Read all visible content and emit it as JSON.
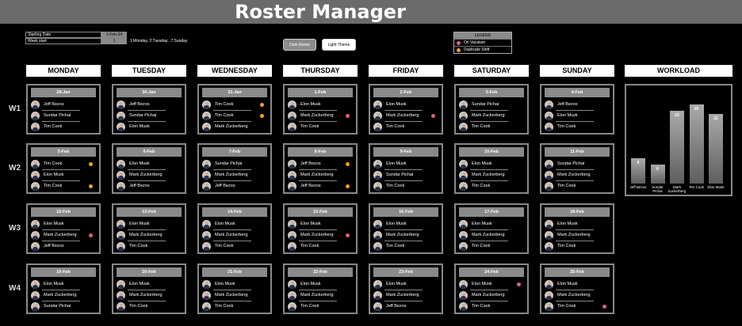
{
  "app": {
    "title": "Roster Manager"
  },
  "settings": {
    "starting_date_label": "Starting Date",
    "starting_date_value": "1-Feb-24",
    "week_start_label": "Week start",
    "week_start_value": "1",
    "week_start_hint": "1:Monday, 2:Tuesday...7:Sunday"
  },
  "theme_buttons": {
    "dark": "Dark theme",
    "light": "Light Theme"
  },
  "legend": {
    "title": "LEGEND",
    "items": [
      {
        "label": "On Vacation",
        "color": "#e0607a"
      },
      {
        "label": "Duplicate Shift",
        "color": "#f0a030"
      }
    ]
  },
  "days": [
    "MONDAY",
    "TUESDAY",
    "WEDNESDAY",
    "THURSDAY",
    "FRIDAY",
    "SATURDAY",
    "SUNDAY"
  ],
  "workload_title": "WORKLOAD",
  "weeks": [
    {
      "label": "W1",
      "cells": [
        {
          "date": "29-Jan",
          "people": [
            {
              "name": "Jeff Bezos"
            },
            {
              "name": "Sundar Pichai"
            },
            {
              "name": "Tim Cook"
            }
          ]
        },
        {
          "date": "30-Jan",
          "people": [
            {
              "name": "Jeff Bezos"
            },
            {
              "name": "Sundar Pichai"
            },
            {
              "name": "Elon Musk"
            }
          ]
        },
        {
          "date": "31-Jan",
          "people": [
            {
              "name": "Tim Cook",
              "mark": "duplicate"
            },
            {
              "name": "Tim Cook",
              "mark": "duplicate"
            },
            {
              "name": "Mark Zuckerberg"
            }
          ]
        },
        {
          "date": "1-Feb",
          "people": [
            {
              "name": "Elon Musk"
            },
            {
              "name": "Mark Zuckerberg",
              "mark": "vacation"
            },
            {
              "name": "Tim Cook"
            }
          ]
        },
        {
          "date": "2-Feb",
          "people": [
            {
              "name": "Elon Musk"
            },
            {
              "name": "Mark Zuckerberg",
              "mark": "vacation"
            },
            {
              "name": "Tim Cook"
            }
          ]
        },
        {
          "date": "3-Feb",
          "people": [
            {
              "name": "Sundar Pichai"
            },
            {
              "name": "Mark Zuckerberg"
            },
            {
              "name": "Tim Cook"
            }
          ]
        },
        {
          "date": "4-Feb",
          "people": [
            {
              "name": "Jeff Bezos"
            },
            {
              "name": "Elon Musk"
            },
            {
              "name": "Tim Cook"
            }
          ]
        }
      ]
    },
    {
      "label": "W2",
      "cells": [
        {
          "date": "5-Feb",
          "people": [
            {
              "name": "Tim Cook",
              "mark": "duplicate"
            },
            {
              "name": "Elon Musk"
            },
            {
              "name": "Tim Cook",
              "mark": "duplicate"
            }
          ]
        },
        {
          "date": "6-Feb",
          "people": [
            {
              "name": "Elon Musk"
            },
            {
              "name": "Mark Zuckerberg"
            },
            {
              "name": "Jeff Bezos"
            }
          ]
        },
        {
          "date": "7-Feb",
          "people": [
            {
              "name": "Sundar Pichai"
            },
            {
              "name": "Mark Zuckerberg"
            },
            {
              "name": "Jeff Bezos"
            }
          ]
        },
        {
          "date": "8-Feb",
          "people": [
            {
              "name": "Jeff Bezos",
              "mark": "duplicate"
            },
            {
              "name": "Mark Zuckerberg"
            },
            {
              "name": "Jeff Bezos",
              "mark": "duplicate"
            }
          ]
        },
        {
          "date": "9-Feb",
          "people": [
            {
              "name": "Elon Musk"
            },
            {
              "name": "Sundar Pichai"
            },
            {
              "name": "Tim Cook"
            }
          ]
        },
        {
          "date": "10-Feb",
          "people": [
            {
              "name": "Elon Musk"
            },
            {
              "name": "Mark Zuckerberg"
            },
            {
              "name": "Tim Cook"
            }
          ]
        },
        {
          "date": "11-Feb",
          "people": [
            {
              "name": "Sundar Pichai"
            },
            {
              "name": "Mark Zuckerberg"
            },
            {
              "name": "Tim Cook"
            }
          ]
        }
      ]
    },
    {
      "label": "W3",
      "cells": [
        {
          "date": "12-Feb",
          "people": [
            {
              "name": "Elon Musk"
            },
            {
              "name": "Mark Zuckerberg",
              "mark": "vacation"
            },
            {
              "name": "Jeff Bezos"
            }
          ]
        },
        {
          "date": "13-Feb",
          "people": [
            {
              "name": "Elon Musk"
            },
            {
              "name": "Mark Zuckerberg"
            },
            {
              "name": "Tim Cook"
            }
          ]
        },
        {
          "date": "14-Feb",
          "people": [
            {
              "name": "Elon Musk"
            },
            {
              "name": "Mark Zuckerberg"
            },
            {
              "name": "Tim Cook"
            }
          ]
        },
        {
          "date": "15-Feb",
          "people": [
            {
              "name": "Elon Musk"
            },
            {
              "name": "Mark Zuckerberg",
              "mark": "vacation"
            },
            {
              "name": "Tim Cook"
            }
          ]
        },
        {
          "date": "16-Feb",
          "people": [
            {
              "name": "Elon Musk"
            },
            {
              "name": "Mark Zuckerberg"
            },
            {
              "name": "Tim Cook"
            }
          ]
        },
        {
          "date": "17-Feb",
          "people": [
            {
              "name": "Elon Musk"
            },
            {
              "name": "Mark Zuckerberg"
            },
            {
              "name": "Tim Cook"
            }
          ]
        },
        {
          "date": "18-Feb",
          "people": [
            {
              "name": "Elon Musk"
            },
            {
              "name": "Mark Zuckerberg"
            },
            {
              "name": "Tim Cook"
            }
          ]
        }
      ]
    },
    {
      "label": "W4",
      "cells": [
        {
          "date": "19-Feb",
          "people": [
            {
              "name": "Elon Musk"
            },
            {
              "name": "Mark Zuckerberg"
            },
            {
              "name": "Sundar Pichai"
            }
          ]
        },
        {
          "date": "20-Feb",
          "people": [
            {
              "name": "Elon Musk"
            },
            {
              "name": "Mark Zuckerberg"
            },
            {
              "name": "Tim Cook"
            }
          ]
        },
        {
          "date": "21-Feb",
          "people": [
            {
              "name": "Elon Musk"
            },
            {
              "name": "Mark Zuckerberg"
            },
            {
              "name": "Tim Cook"
            }
          ]
        },
        {
          "date": "22-Feb",
          "people": [
            {
              "name": "Elon Musk"
            },
            {
              "name": "Mark Zuckerberg"
            },
            {
              "name": "Tim Cook"
            }
          ]
        },
        {
          "date": "23-Feb",
          "people": [
            {
              "name": "Elon Musk"
            },
            {
              "name": "Mark Zuckerberg"
            },
            {
              "name": "Jeff Bezos"
            }
          ]
        },
        {
          "date": "24-Feb",
          "people": [
            {
              "name": "Elon Musk",
              "mark": "vacation"
            },
            {
              "name": "Mark Zuckerberg"
            },
            {
              "name": "Tim Cook"
            }
          ]
        },
        {
          "date": "25-Feb",
          "people": [
            {
              "name": "Elon Musk"
            },
            {
              "name": "Mark Zuckerberg"
            },
            {
              "name": "Tim Cook",
              "mark": "vacation"
            }
          ]
        }
      ]
    }
  ],
  "chart_data": {
    "type": "bar",
    "categories": [
      "Jeff Bezos",
      "Sundar Pichai",
      "Mark Zuckerberg",
      "Tim Cook",
      "Elon Musk"
    ],
    "values": [
      8,
      6,
      23,
      25,
      22
    ],
    "title": "WORKLOAD",
    "xlabel": "",
    "ylabel": "",
    "ylim": [
      0,
      26
    ],
    "grid": false
  }
}
